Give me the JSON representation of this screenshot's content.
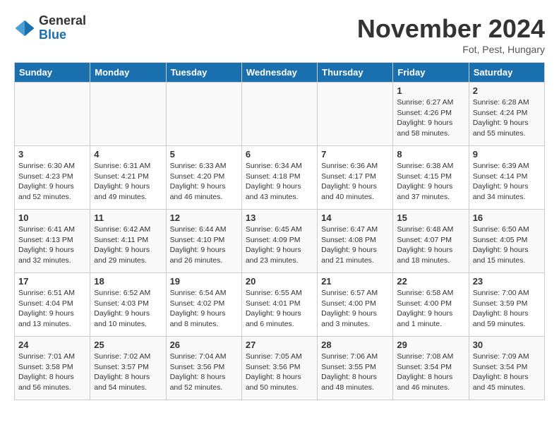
{
  "logo": {
    "general": "General",
    "blue": "Blue"
  },
  "title": "November 2024",
  "subtitle": "Fot, Pest, Hungary",
  "days_of_week": [
    "Sunday",
    "Monday",
    "Tuesday",
    "Wednesday",
    "Thursday",
    "Friday",
    "Saturday"
  ],
  "weeks": [
    [
      {
        "day": "",
        "detail": ""
      },
      {
        "day": "",
        "detail": ""
      },
      {
        "day": "",
        "detail": ""
      },
      {
        "day": "",
        "detail": ""
      },
      {
        "day": "",
        "detail": ""
      },
      {
        "day": "1",
        "detail": "Sunrise: 6:27 AM\nSunset: 4:26 PM\nDaylight: 9 hours and 58 minutes."
      },
      {
        "day": "2",
        "detail": "Sunrise: 6:28 AM\nSunset: 4:24 PM\nDaylight: 9 hours and 55 minutes."
      }
    ],
    [
      {
        "day": "3",
        "detail": "Sunrise: 6:30 AM\nSunset: 4:23 PM\nDaylight: 9 hours and 52 minutes."
      },
      {
        "day": "4",
        "detail": "Sunrise: 6:31 AM\nSunset: 4:21 PM\nDaylight: 9 hours and 49 minutes."
      },
      {
        "day": "5",
        "detail": "Sunrise: 6:33 AM\nSunset: 4:20 PM\nDaylight: 9 hours and 46 minutes."
      },
      {
        "day": "6",
        "detail": "Sunrise: 6:34 AM\nSunset: 4:18 PM\nDaylight: 9 hours and 43 minutes."
      },
      {
        "day": "7",
        "detail": "Sunrise: 6:36 AM\nSunset: 4:17 PM\nDaylight: 9 hours and 40 minutes."
      },
      {
        "day": "8",
        "detail": "Sunrise: 6:38 AM\nSunset: 4:15 PM\nDaylight: 9 hours and 37 minutes."
      },
      {
        "day": "9",
        "detail": "Sunrise: 6:39 AM\nSunset: 4:14 PM\nDaylight: 9 hours and 34 minutes."
      }
    ],
    [
      {
        "day": "10",
        "detail": "Sunrise: 6:41 AM\nSunset: 4:13 PM\nDaylight: 9 hours and 32 minutes."
      },
      {
        "day": "11",
        "detail": "Sunrise: 6:42 AM\nSunset: 4:11 PM\nDaylight: 9 hours and 29 minutes."
      },
      {
        "day": "12",
        "detail": "Sunrise: 6:44 AM\nSunset: 4:10 PM\nDaylight: 9 hours and 26 minutes."
      },
      {
        "day": "13",
        "detail": "Sunrise: 6:45 AM\nSunset: 4:09 PM\nDaylight: 9 hours and 23 minutes."
      },
      {
        "day": "14",
        "detail": "Sunrise: 6:47 AM\nSunset: 4:08 PM\nDaylight: 9 hours and 21 minutes."
      },
      {
        "day": "15",
        "detail": "Sunrise: 6:48 AM\nSunset: 4:07 PM\nDaylight: 9 hours and 18 minutes."
      },
      {
        "day": "16",
        "detail": "Sunrise: 6:50 AM\nSunset: 4:05 PM\nDaylight: 9 hours and 15 minutes."
      }
    ],
    [
      {
        "day": "17",
        "detail": "Sunrise: 6:51 AM\nSunset: 4:04 PM\nDaylight: 9 hours and 13 minutes."
      },
      {
        "day": "18",
        "detail": "Sunrise: 6:52 AM\nSunset: 4:03 PM\nDaylight: 9 hours and 10 minutes."
      },
      {
        "day": "19",
        "detail": "Sunrise: 6:54 AM\nSunset: 4:02 PM\nDaylight: 9 hours and 8 minutes."
      },
      {
        "day": "20",
        "detail": "Sunrise: 6:55 AM\nSunset: 4:01 PM\nDaylight: 9 hours and 6 minutes."
      },
      {
        "day": "21",
        "detail": "Sunrise: 6:57 AM\nSunset: 4:00 PM\nDaylight: 9 hours and 3 minutes."
      },
      {
        "day": "22",
        "detail": "Sunrise: 6:58 AM\nSunset: 4:00 PM\nDaylight: 9 hours and 1 minute."
      },
      {
        "day": "23",
        "detail": "Sunrise: 7:00 AM\nSunset: 3:59 PM\nDaylight: 8 hours and 59 minutes."
      }
    ],
    [
      {
        "day": "24",
        "detail": "Sunrise: 7:01 AM\nSunset: 3:58 PM\nDaylight: 8 hours and 56 minutes."
      },
      {
        "day": "25",
        "detail": "Sunrise: 7:02 AM\nSunset: 3:57 PM\nDaylight: 8 hours and 54 minutes."
      },
      {
        "day": "26",
        "detail": "Sunrise: 7:04 AM\nSunset: 3:56 PM\nDaylight: 8 hours and 52 minutes."
      },
      {
        "day": "27",
        "detail": "Sunrise: 7:05 AM\nSunset: 3:56 PM\nDaylight: 8 hours and 50 minutes."
      },
      {
        "day": "28",
        "detail": "Sunrise: 7:06 AM\nSunset: 3:55 PM\nDaylight: 8 hours and 48 minutes."
      },
      {
        "day": "29",
        "detail": "Sunrise: 7:08 AM\nSunset: 3:54 PM\nDaylight: 8 hours and 46 minutes."
      },
      {
        "day": "30",
        "detail": "Sunrise: 7:09 AM\nSunset: 3:54 PM\nDaylight: 8 hours and 45 minutes."
      }
    ]
  ]
}
